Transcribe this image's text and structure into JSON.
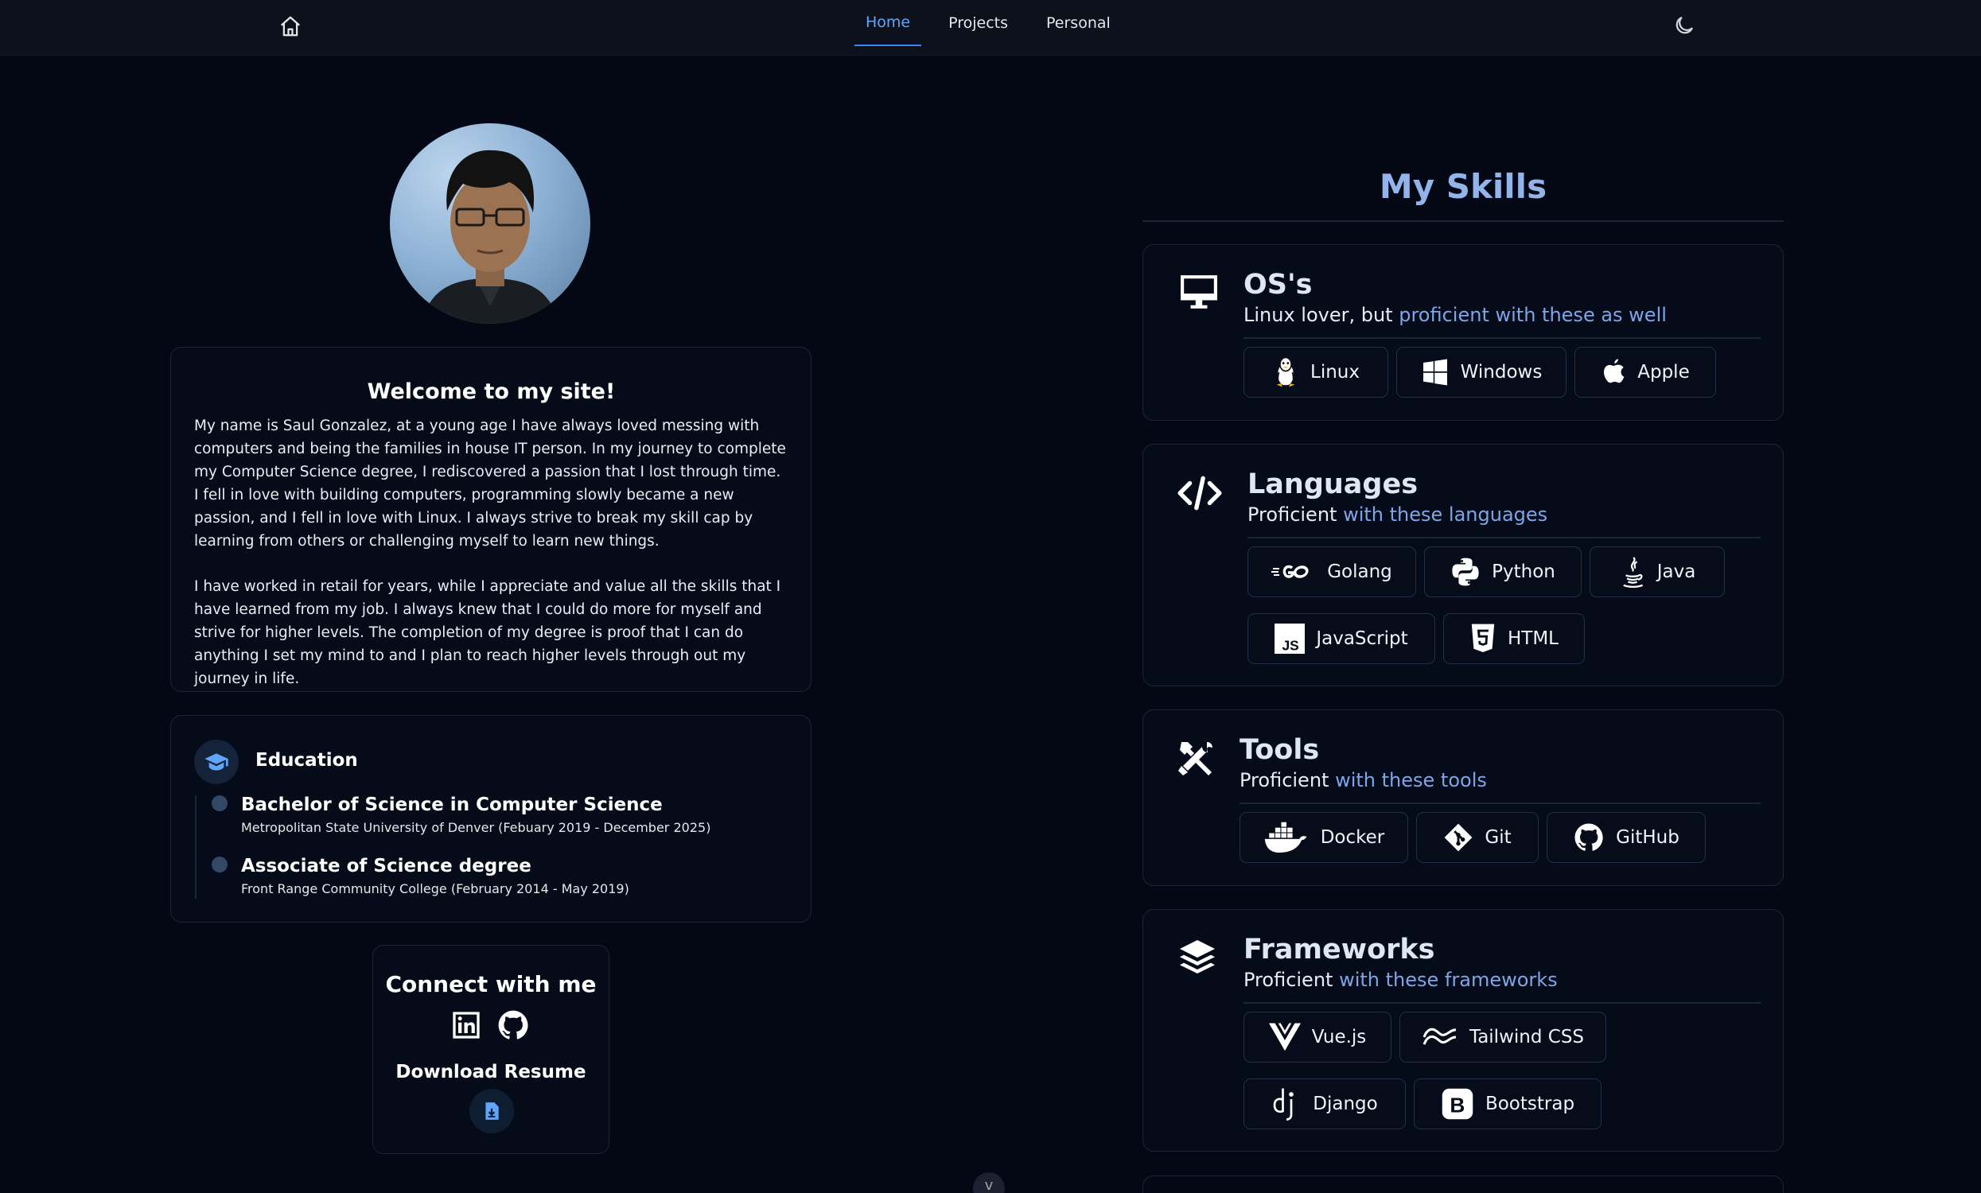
{
  "nav": {
    "links": [
      {
        "label": "Home",
        "active": true
      },
      {
        "label": "Projects"
      },
      {
        "label": "Personal"
      }
    ],
    "home_icon": "home-icon",
    "theme_icon": "moon-icon"
  },
  "welcome": {
    "title": "Welcome to my site!",
    "paragraphs": [
      "My name is Saul Gonzalez, at a young age I have always loved messing with computers and being the families in house IT person. In my journey to complete my Computer Science degree, I rediscovered a passion that I lost through time. I fell in love with building computers, programming slowly became a new passion, and I fell in love with Linux. I always strive to break my skill cap by learning from others or challenging myself to learn new things.",
      "I have worked in retail for years, while I appreciate and value all the skills that I have learned from my job. I always knew that I could do more for myself and strive for higher levels. The completion of my degree is proof that I can do anything I set my mind to and I plan to reach higher levels through out my journey in life."
    ]
  },
  "education": {
    "title": "Education",
    "items": [
      {
        "degree": "Bachelor of Science in Computer Science",
        "school": "Metropolitan State University of Denver (Febuary 2019 - December 2025)"
      },
      {
        "degree": "Associate of Science degree",
        "school": "Front Range Community College (February 2014 - May 2019)"
      }
    ]
  },
  "connect": {
    "title": "Connect with me",
    "download": "Download Resume"
  },
  "skills": {
    "title": "My Skills",
    "sections": [
      {
        "title": "OS's",
        "sub_plain": "Linux lover, but ",
        "sub_hl_1": "proficient",
        "sub_mid": " with ",
        "sub_hl_2": "these as well",
        "items": [
          "Linux",
          "Windows",
          "Apple"
        ]
      },
      {
        "title": "Languages",
        "sub_plain": "Proficient",
        "sub_mid": " with ",
        "sub_hl_2": "these languages",
        "items": [
          "Golang",
          "Python",
          "Java",
          "JavaScript",
          "HTML"
        ]
      },
      {
        "title": "Tools",
        "sub_plain": "Proficient",
        "sub_mid": " with ",
        "sub_hl_2": "these tools",
        "items": [
          "Docker",
          "Git",
          "GitHub"
        ]
      },
      {
        "title": "Frameworks",
        "sub_plain": "Proficient",
        "sub_mid": " with ",
        "sub_hl_2": "these frameworks",
        "items": [
          "Vue.js",
          "Tailwind CSS",
          "Django",
          "Bootstrap"
        ]
      }
    ]
  },
  "colors": {
    "accent": "#60a5fa",
    "background": "#030814",
    "heading": "#93b4e8"
  }
}
